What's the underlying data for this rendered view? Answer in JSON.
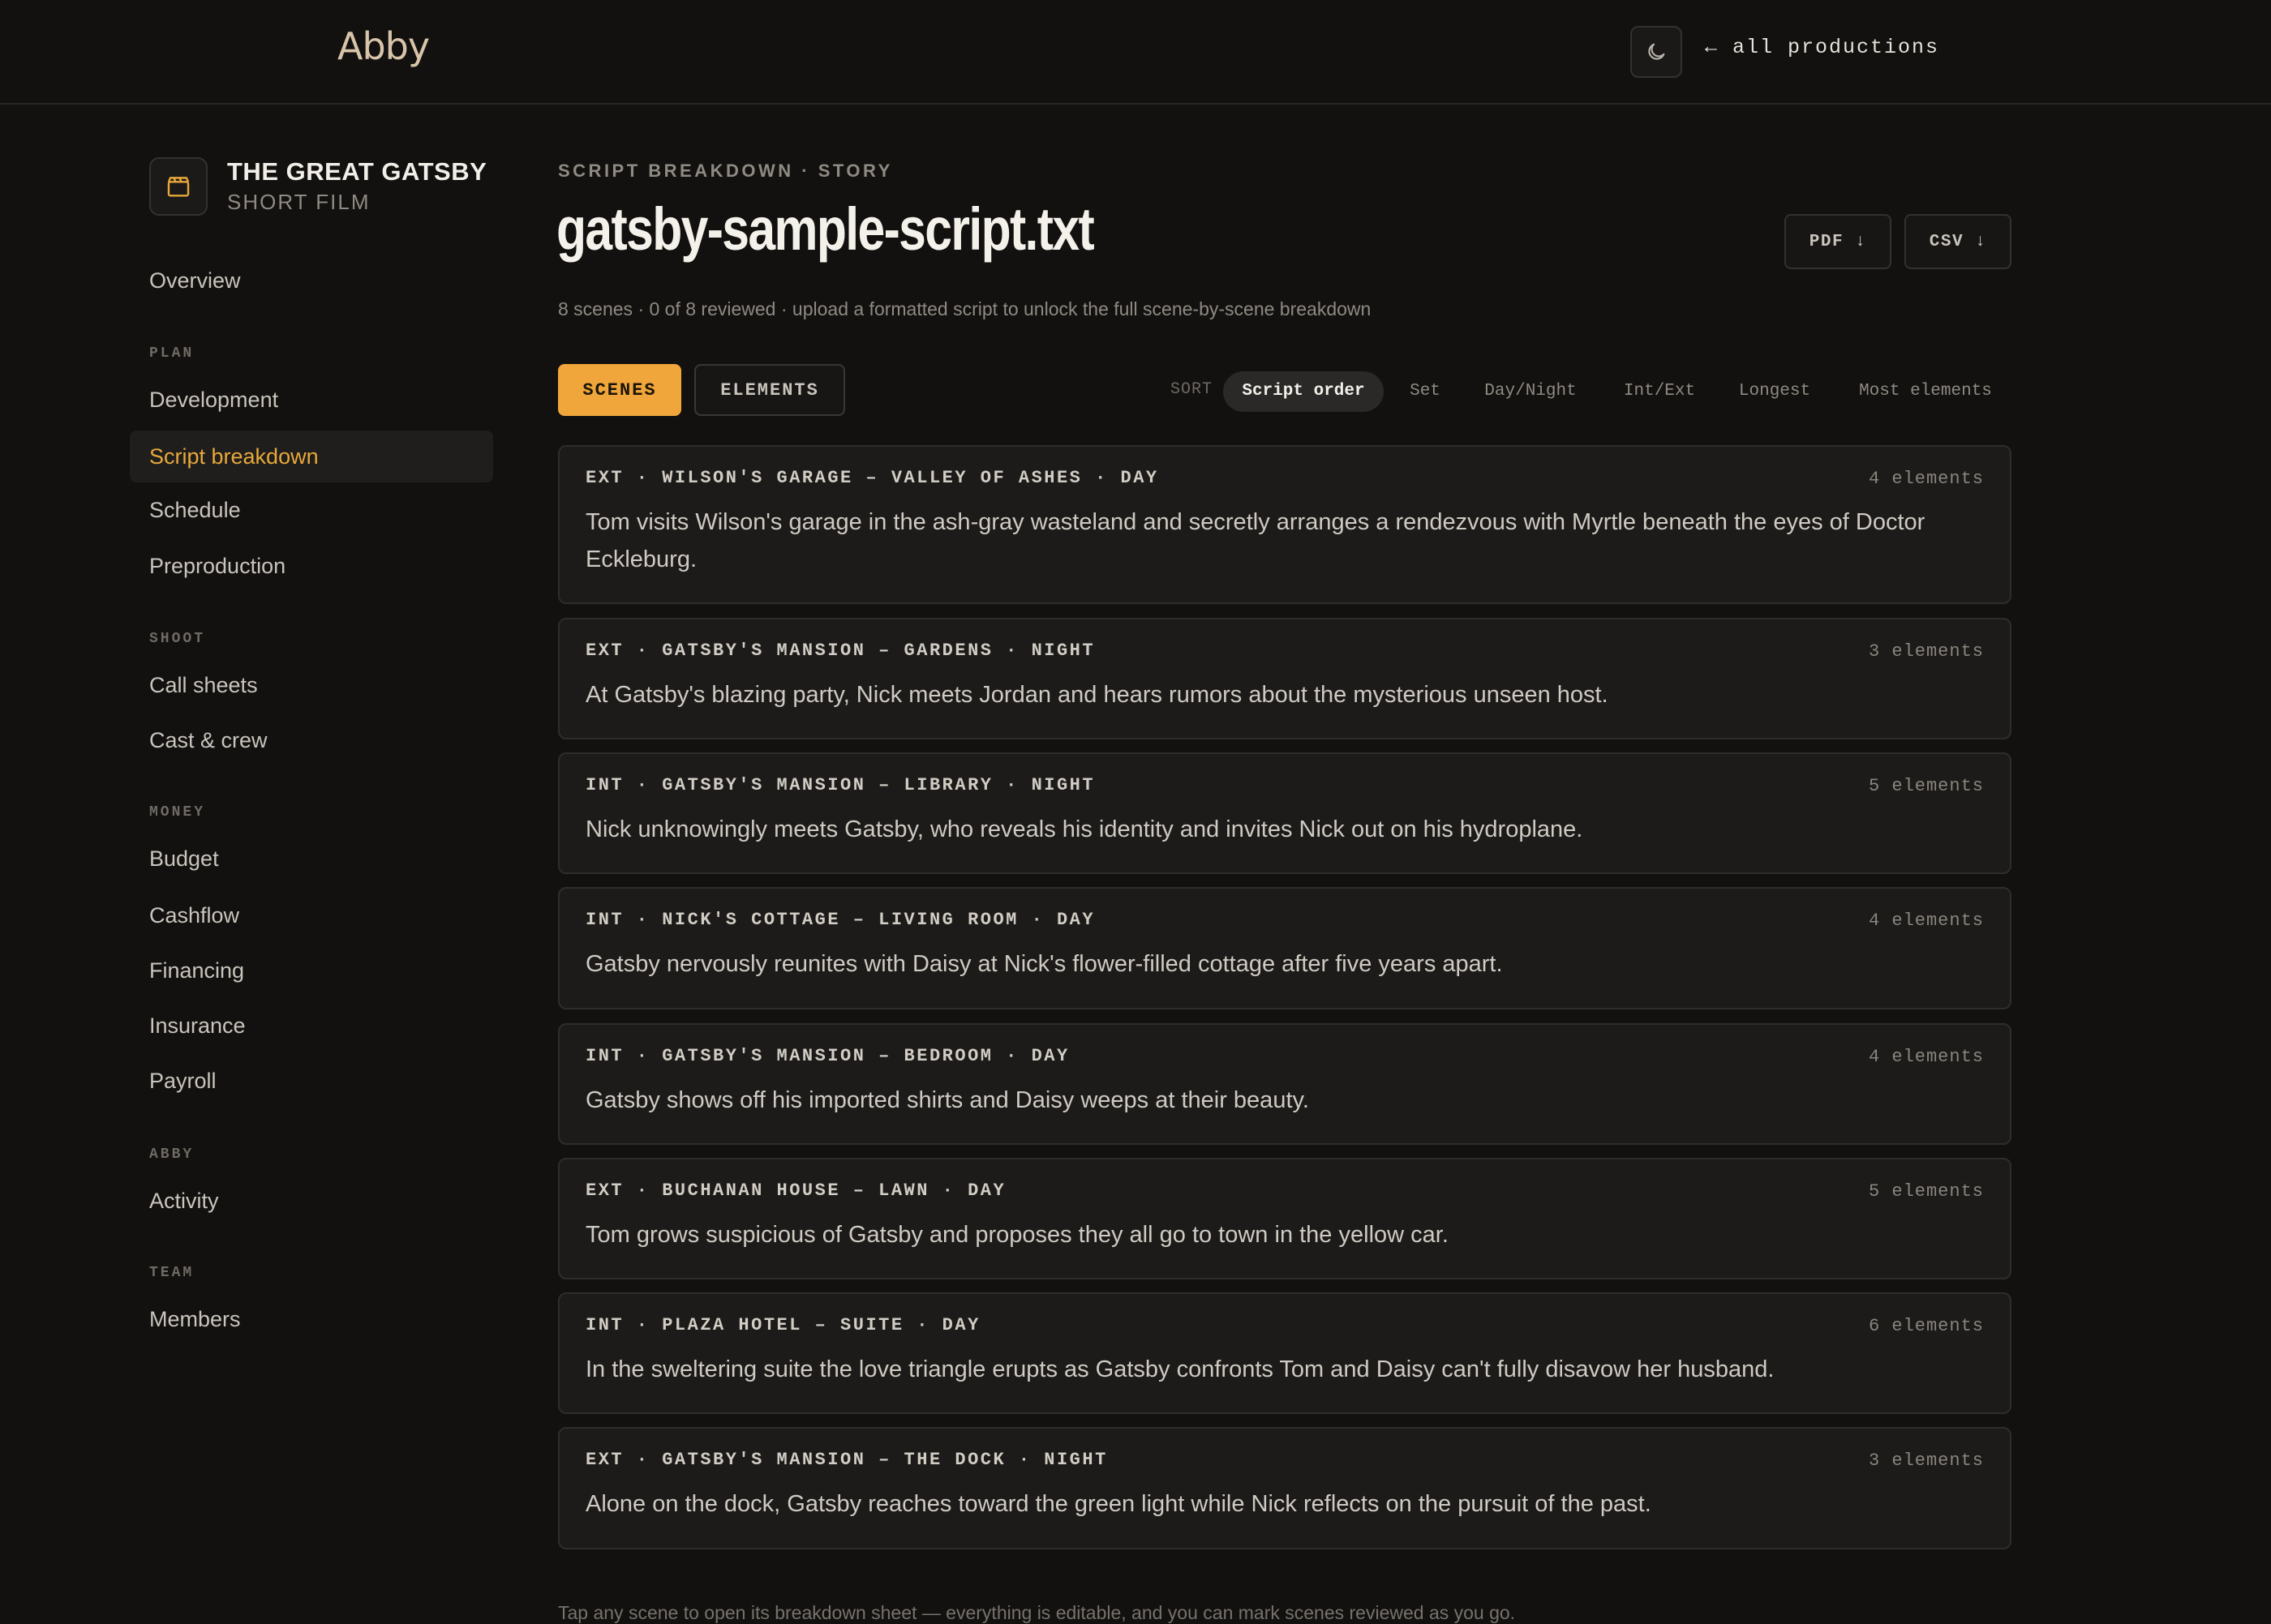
{
  "header": {
    "logo": "Abby",
    "theme_toggle_icon": "moon-icon",
    "back_link": "← all productions"
  },
  "project": {
    "title": "THE GREAT GATSBY",
    "subtitle": "SHORT FILM",
    "icon": "clapperboard-icon"
  },
  "sidebar": {
    "overview": "Overview",
    "sections": {
      "plan": "PLAN",
      "shoot": "SHOOT",
      "money": "MONEY",
      "abby": "ABBY",
      "team": "TEAM"
    },
    "items": {
      "development": "Development",
      "script_breakdown": "Script breakdown",
      "schedule": "Schedule",
      "preproduction": "Preproduction",
      "call_sheets": "Call sheets",
      "cast_crew": "Cast & crew",
      "budget": "Budget",
      "cashflow": "Cashflow",
      "financing": "Financing",
      "insurance": "Insurance",
      "payroll": "Payroll",
      "activity": "Activity",
      "members": "Members"
    },
    "active": "script_breakdown"
  },
  "main": {
    "eyebrow": "SCRIPT BREAKDOWN · STORY",
    "title": "gatsby-sample-script.txt",
    "meta": "8 scenes · 0 of 8 reviewed · upload a formatted script to unlock the full scene-by-scene breakdown",
    "export_pdf": "PDF ↓",
    "export_csv": "CSV ↓",
    "tabs": {
      "scenes": "SCENES",
      "elements": "ELEMENTS"
    },
    "sort": {
      "label": "SORT",
      "options": [
        "Script order",
        "Set",
        "Day/Night",
        "Int/Ext",
        "Longest",
        "Most elements"
      ],
      "selected": "Script order"
    },
    "scenes": [
      {
        "heading": "EXT · WILSON'S GARAGE – VALLEY OF ASHES · DAY",
        "count": "4 elements",
        "desc": "Tom visits Wilson's garage in the ash-gray wasteland and secretly arranges a rendezvous with Myrtle beneath the eyes of Doctor Eckleburg."
      },
      {
        "heading": "EXT · GATSBY'S MANSION – GARDENS · NIGHT",
        "count": "3 elements",
        "desc": "At Gatsby's blazing party, Nick meets Jordan and hears rumors about the mysterious unseen host."
      },
      {
        "heading": "INT · GATSBY'S MANSION – LIBRARY · NIGHT",
        "count": "5 elements",
        "desc": "Nick unknowingly meets Gatsby, who reveals his identity and invites Nick out on his hydroplane."
      },
      {
        "heading": "INT · NICK'S COTTAGE – LIVING ROOM · DAY",
        "count": "4 elements",
        "desc": "Gatsby nervously reunites with Daisy at Nick's flower-filled cottage after five years apart."
      },
      {
        "heading": "INT · GATSBY'S MANSION – BEDROOM · DAY",
        "count": "4 elements",
        "desc": "Gatsby shows off his imported shirts and Daisy weeps at their beauty."
      },
      {
        "heading": "EXT · BUCHANAN HOUSE – LAWN · DAY",
        "count": "5 elements",
        "desc": "Tom grows suspicious of Gatsby and proposes they all go to town in the yellow car."
      },
      {
        "heading": "INT · PLAZA HOTEL – SUITE · DAY",
        "count": "6 elements",
        "desc": "In the sweltering suite the love triangle erupts as Gatsby confronts Tom and Daisy can't fully disavow her husband."
      },
      {
        "heading": "EXT · GATSBY'S MANSION – THE DOCK · NIGHT",
        "count": "3 elements",
        "desc": "Alone on the dock, Gatsby reaches toward the green light while Nick reflects on the pursuit of the past."
      }
    ],
    "footer_note": "Tap any scene to open its breakdown sheet — everything is editable, and you can mark scenes reviewed as you go."
  },
  "colors": {
    "background": "#121110",
    "accent": "#f0a63a",
    "card": "#1c1b1a"
  }
}
